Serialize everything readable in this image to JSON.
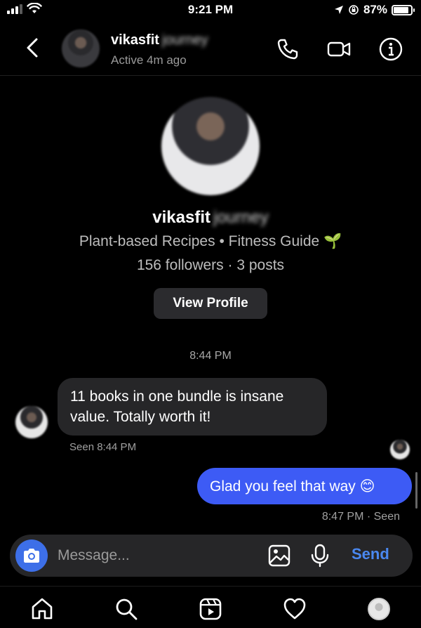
{
  "status_bar": {
    "time": "9:21 PM",
    "battery": "87%",
    "battery_fraction": 0.87
  },
  "header": {
    "name": "vikasfit",
    "name_blurred_suffix": "journey",
    "status": "Active 4m ago"
  },
  "profile": {
    "name": "vikasfit",
    "name_blurred_suffix": "journey",
    "bio": "Plant-based Recipes • Fitness Guide 🌱",
    "stats": "156 followers · 3 posts",
    "view_profile_label": "View Profile"
  },
  "conversation": {
    "timestamp": "8:44 PM",
    "messages": [
      {
        "direction": "incoming",
        "text": "11 books in one bundle is insane value. Totally worth it!",
        "meta": "Seen 8:44 PM"
      },
      {
        "direction": "outgoing",
        "text": "Glad you feel that way 😊",
        "meta": "8:47 PM · Seen"
      }
    ]
  },
  "composer": {
    "placeholder": "Message...",
    "send_label": "Send"
  },
  "nav": {
    "items": [
      "home-icon",
      "search-icon",
      "reels-icon",
      "heart-icon",
      "profile-avatar"
    ]
  },
  "colors": {
    "accent": "#3d5bf5",
    "send": "#4a88f0",
    "camera": "#3d6fe8",
    "bubble_in": "#262628",
    "background": "#000000"
  }
}
